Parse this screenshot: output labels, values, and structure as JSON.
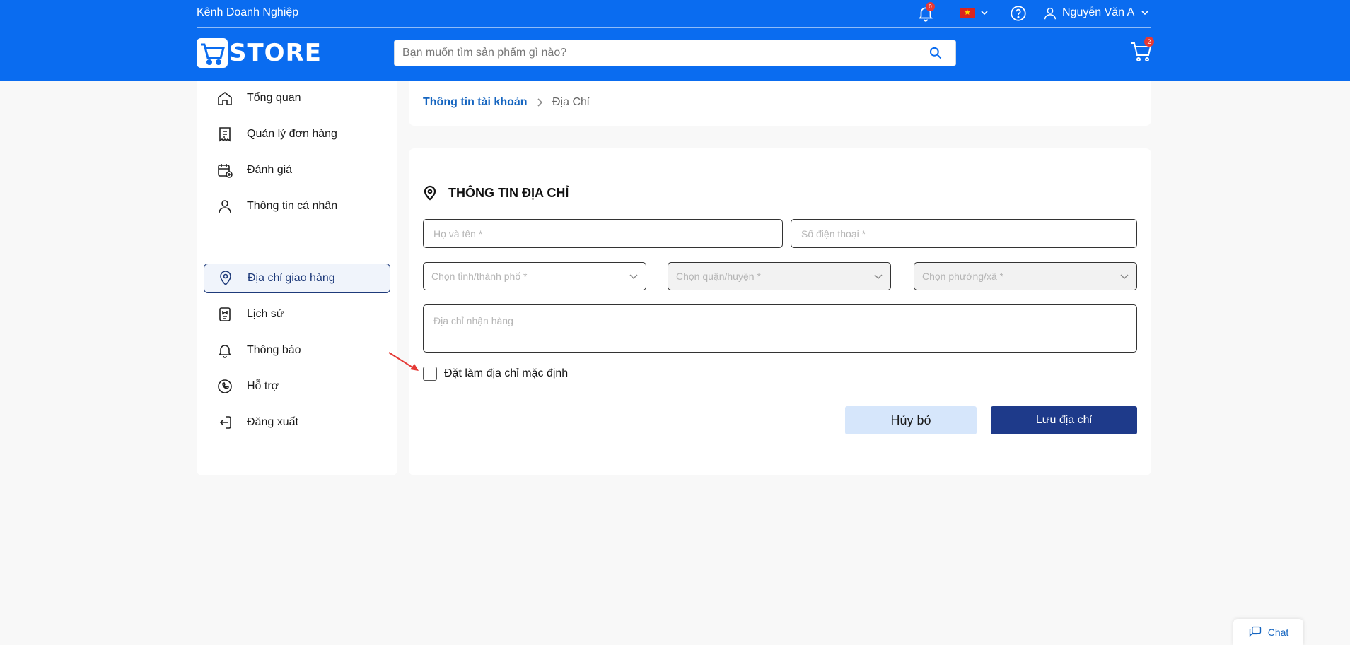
{
  "colors": {
    "brand": "#0a6cf0",
    "primary_dark": "#1e3a8a",
    "link": "#1565c0",
    "badge": "#e53935"
  },
  "header": {
    "business_channel": "Kênh Doanh Nghiệp",
    "notification_count": "0",
    "language_flag": "vietnam-flag",
    "user_name": "Nguyễn Văn A",
    "logo_text": "STORE",
    "search_placeholder": "Bạn muốn tìm sản phẩm gì nào?",
    "cart_count": "2"
  },
  "sidebar": {
    "items": [
      {
        "label": "Tổng quan",
        "icon": "home-icon",
        "active": false
      },
      {
        "label": "Quản lý đơn hàng",
        "icon": "receipt-icon",
        "active": false
      },
      {
        "label": "Đánh giá",
        "icon": "calendar-add-icon",
        "active": false
      },
      {
        "label": "Thông tin cá nhân",
        "icon": "user-icon",
        "active": false
      },
      {
        "label": "Địa chỉ giao hàng",
        "icon": "location-icon",
        "active": true
      },
      {
        "label": "Lịch sử",
        "icon": "history-icon",
        "active": false
      },
      {
        "label": "Thông báo",
        "icon": "bell-icon",
        "active": false
      },
      {
        "label": "Hỗ trợ",
        "icon": "phone-support-icon",
        "active": false
      },
      {
        "label": "Đăng xuất",
        "icon": "logout-icon",
        "active": false
      }
    ]
  },
  "breadcrumb": {
    "parent": "Thông tin tài khoản",
    "current": "Địa Chỉ"
  },
  "form": {
    "title": "THÔNG TIN ĐỊA CHỈ",
    "name_placeholder": "Họ và tên *",
    "phone_placeholder": "Số điện thoại *",
    "province_placeholder": "Chọn tỉnh/thành phố *",
    "district_placeholder": "Chọn quận/huyện *",
    "ward_placeholder": "Chọn phường/xã *",
    "address_placeholder": "Địa chỉ nhận hàng",
    "default_label": "Đặt làm địa chỉ mặc định",
    "cancel_label": "Hủy bỏ",
    "save_label": "Lưu địa chỉ"
  },
  "chat": {
    "label": "Chat"
  }
}
